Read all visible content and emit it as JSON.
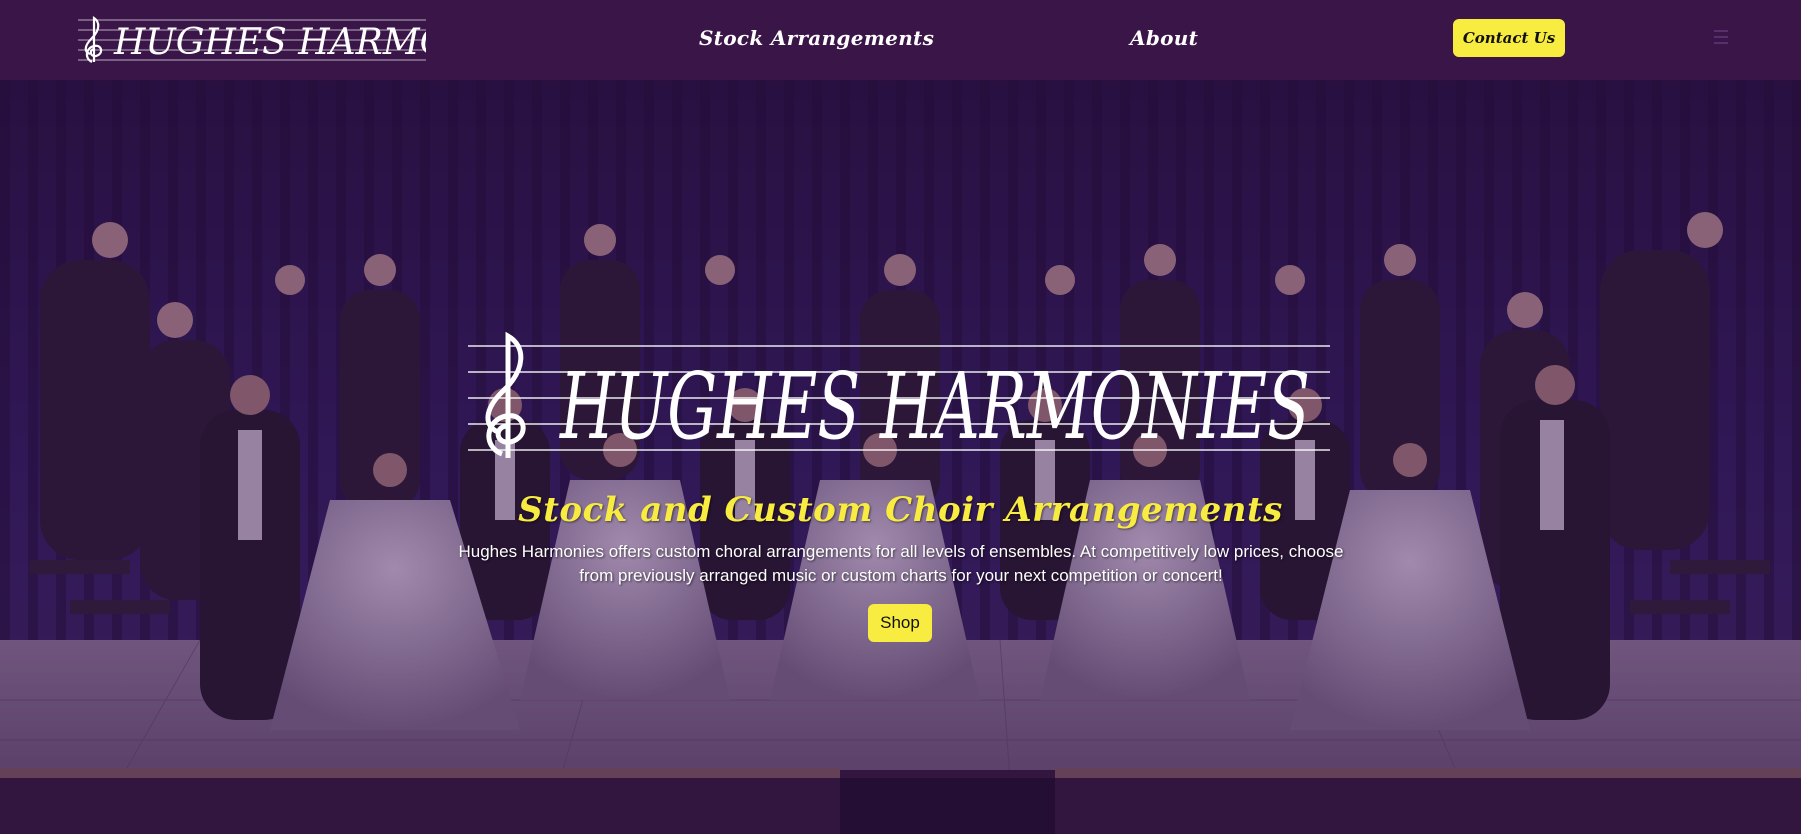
{
  "brand": {
    "name": "HUGHES HARMONIES",
    "logo_alt": "Hughes Harmonies"
  },
  "nav": {
    "links": [
      {
        "label": "Stock Arrangements"
      },
      {
        "label": "About"
      }
    ],
    "contact_label": "Contact Us",
    "menu_icon": "hamburger-icon"
  },
  "hero": {
    "logo_text": "HUGHES HARMONIES",
    "heading": "Stock and Custom Choir Arrangements",
    "description": "Hughes Harmonies offers custom choral arrangements for all levels of ensembles. At competitively low prices, choose from previously arranged music or custom charts for your next competition or concert!",
    "shop_label": "Shop",
    "background_icon": "choir-photo-image"
  },
  "colors": {
    "nav_bg": "#3a1547",
    "accent_yellow": "#f7ec3f",
    "hero_tint": "#3c1450"
  }
}
